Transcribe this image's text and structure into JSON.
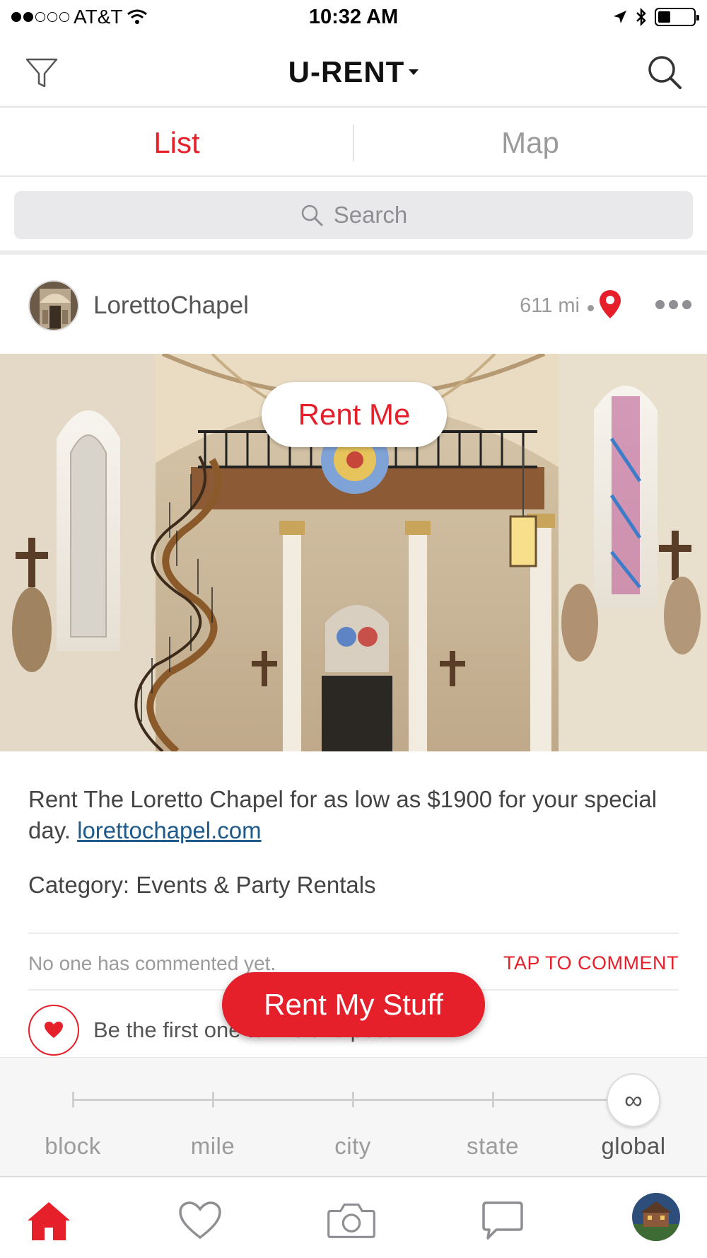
{
  "status_bar": {
    "carrier": "AT&T",
    "time": "10:32 AM",
    "battery_level": 0.35
  },
  "nav": {
    "title": "U-RENT"
  },
  "tabs": [
    {
      "label": "List",
      "active": true
    },
    {
      "label": "Map",
      "active": false
    }
  ],
  "search": {
    "placeholder": "Search"
  },
  "post": {
    "username": "LorettoChapel",
    "distance": "611 mi",
    "rent_me_label": "Rent Me",
    "description": "Rent The Loretto Chapel for as low as $1900 for your special day.",
    "link": "lorettochapel.com",
    "category": "Category: Events & Party Rentals",
    "comments_text": "No one has commented yet.",
    "tap_to_comment": "TAP TO COMMENT",
    "likes_text": "Be the first one to like this post."
  },
  "fab": {
    "label": "Rent My Stuff"
  },
  "range": {
    "labels": [
      "block",
      "mile",
      "city",
      "state",
      "global"
    ],
    "selected": "global",
    "knob_symbol": "∞"
  },
  "tab_bar": {
    "items": [
      "home-icon",
      "heart-icon",
      "camera-icon",
      "chat-icon",
      "profile-avatar"
    ],
    "active": "home-icon"
  },
  "colors": {
    "accent": "#e5202b",
    "link": "#1f5a8a"
  }
}
